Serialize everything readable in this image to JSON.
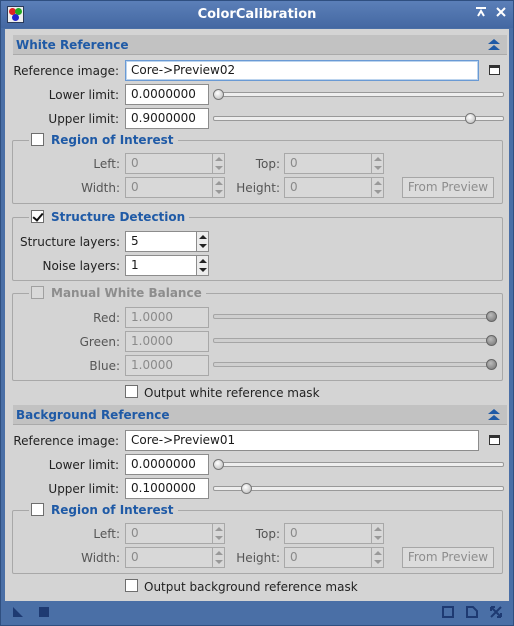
{
  "window": {
    "title": "ColorCalibration"
  },
  "colors": {
    "accent": "#1f5aa6",
    "titlebar": "#4a6fa6",
    "panel": "#d4d4d4"
  },
  "white_reference": {
    "section_label": "White Reference",
    "reference_image_label": "Reference image:",
    "reference_image_value": "Core->Preview02",
    "lower_limit_label": "Lower limit:",
    "lower_limit_value": "0.0000000",
    "lower_limit_fraction": 0.0,
    "upper_limit_label": "Upper limit:",
    "upper_limit_value": "0.9000000",
    "upper_limit_fraction": 0.9,
    "roi": {
      "title": "Region of Interest",
      "checked": false,
      "left_label": "Left:",
      "left_value": "0",
      "top_label": "Top:",
      "top_value": "0",
      "width_label": "Width:",
      "width_value": "0",
      "height_label": "Height:",
      "height_value": "0",
      "from_preview_label": "From Preview"
    },
    "structure": {
      "title": "Structure Detection",
      "checked": true,
      "layers_label": "Structure layers:",
      "layers_value": "5",
      "noise_label": "Noise layers:",
      "noise_value": "1"
    },
    "manual": {
      "title": "Manual White Balance",
      "checked": false,
      "red_label": "Red:",
      "red_value": "1.0000",
      "green_label": "Green:",
      "green_value": "1.0000",
      "blue_label": "Blue:",
      "blue_value": "1.0000"
    },
    "output_mask_label": "Output white reference mask"
  },
  "background_reference": {
    "section_label": "Background Reference",
    "reference_image_label": "Reference image:",
    "reference_image_value": "Core->Preview01",
    "lower_limit_label": "Lower limit:",
    "lower_limit_value": "0.0000000",
    "lower_limit_fraction": 0.0,
    "upper_limit_label": "Upper limit:",
    "upper_limit_value": "0.1000000",
    "upper_limit_fraction": 0.1,
    "roi": {
      "title": "Region of Interest",
      "checked": false,
      "left_label": "Left:",
      "left_value": "0",
      "top_label": "Top:",
      "top_value": "0",
      "width_label": "Width:",
      "width_value": "0",
      "height_label": "Height:",
      "height_value": "0",
      "from_preview_label": "From Preview"
    },
    "output_mask_label": "Output background reference mask"
  }
}
